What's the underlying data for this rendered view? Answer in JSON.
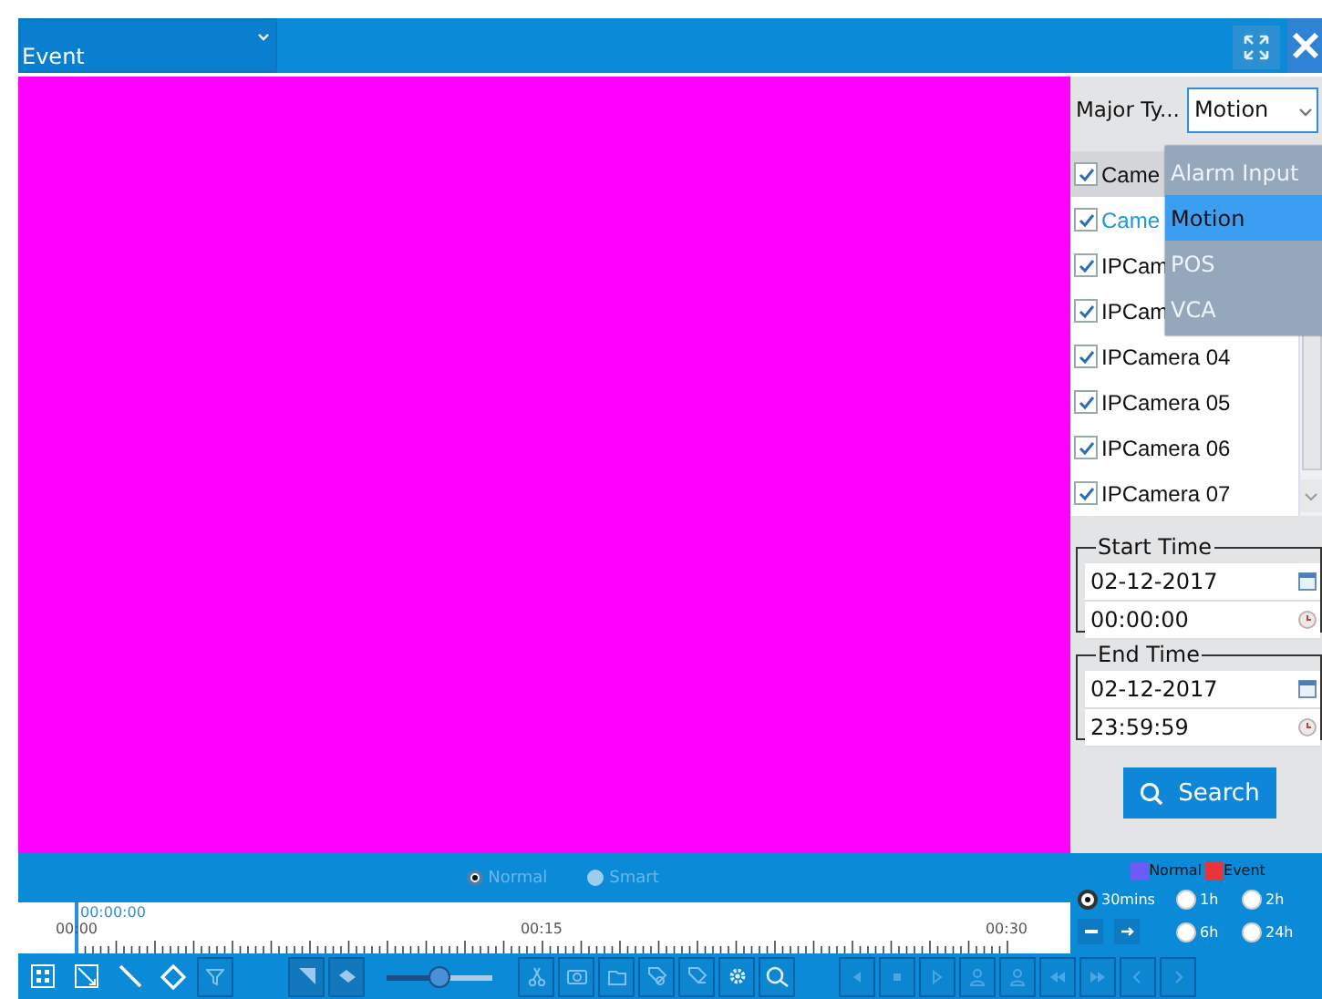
{
  "header": {
    "event_select": "Event"
  },
  "filter": {
    "label": "Major Ty...",
    "major_type": "Motion",
    "menu": [
      {
        "label": "Alarm Input",
        "selected": false
      },
      {
        "label": "Motion",
        "selected": true
      },
      {
        "label": "POS",
        "selected": false
      },
      {
        "label": "VCA",
        "selected": false
      }
    ]
  },
  "cameras": [
    {
      "label": "Came",
      "kind": "header",
      "checked": true,
      "selected": false
    },
    {
      "label": "Came",
      "kind": "item",
      "checked": true,
      "selected": true
    },
    {
      "label": "IPCam",
      "kind": "item",
      "checked": true,
      "selected": false
    },
    {
      "label": "IPCam",
      "kind": "item",
      "checked": true,
      "selected": false
    },
    {
      "label": "IPCamera 04",
      "kind": "item",
      "checked": true,
      "selected": false
    },
    {
      "label": "IPCamera 05",
      "kind": "item",
      "checked": true,
      "selected": false
    },
    {
      "label": "IPCamera 06",
      "kind": "item",
      "checked": true,
      "selected": false
    },
    {
      "label": "IPCamera 07",
      "kind": "item",
      "checked": true,
      "selected": false
    }
  ],
  "start_time": {
    "legend": "Start Time",
    "date": "02-12-2017",
    "time": "00:00:00"
  },
  "end_time": {
    "legend": "End Time",
    "date": "02-12-2017",
    "time": "23:59:59"
  },
  "search_button": "Search",
  "stream_modes": [
    {
      "label": "Normal",
      "selected": true,
      "disabled": true
    },
    {
      "label": "Smart",
      "selected": false,
      "disabled": true
    }
  ],
  "legend": [
    {
      "label": "Normal",
      "color": "#6c5cf5"
    },
    {
      "label": "Event",
      "color": "#e8343a"
    }
  ],
  "timeline": {
    "cursor": "00:00:00",
    "ticks": [
      "00:00",
      "00:15",
      "00:30"
    ]
  },
  "zoom_options": [
    {
      "label": "30mins",
      "selected": true
    },
    {
      "label": "1h",
      "selected": false
    },
    {
      "label": "2h",
      "selected": false
    },
    {
      "label": "6h",
      "selected": false
    },
    {
      "label": "24h",
      "selected": false
    }
  ],
  "speed_slider": {
    "level": 0.5
  }
}
